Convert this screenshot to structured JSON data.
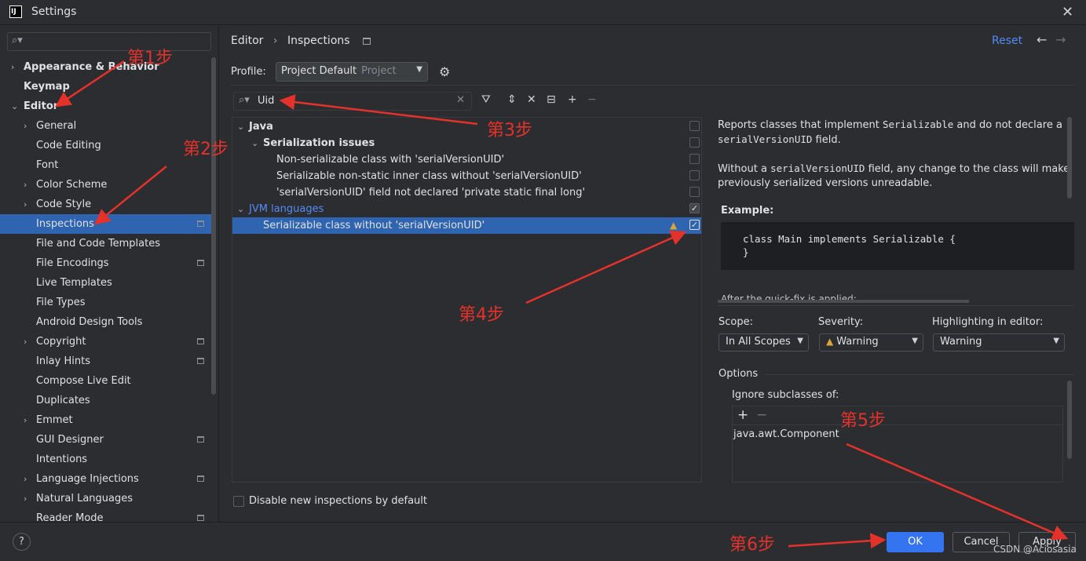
{
  "window": {
    "title": "Settings",
    "app_icon": "IJ"
  },
  "sidebar": {
    "items": [
      {
        "label": "Appearance & Behavior",
        "level": 0,
        "chevron": "right",
        "bold": true,
        "options_icon": false
      },
      {
        "label": "Keymap",
        "level": 0,
        "chevron": "none",
        "bold": true,
        "options_icon": false
      },
      {
        "label": "Editor",
        "level": 0,
        "chevron": "down",
        "bold": true,
        "options_icon": false
      },
      {
        "label": "General",
        "level": 1,
        "chevron": "right",
        "bold": false,
        "options_icon": false
      },
      {
        "label": "Code Editing",
        "level": 1,
        "chevron": "none",
        "bold": false,
        "options_icon": false
      },
      {
        "label": "Font",
        "level": 1,
        "chevron": "none",
        "bold": false,
        "options_icon": false
      },
      {
        "label": "Color Scheme",
        "level": 1,
        "chevron": "right",
        "bold": false,
        "options_icon": false
      },
      {
        "label": "Code Style",
        "level": 1,
        "chevron": "right",
        "bold": false,
        "options_icon": false
      },
      {
        "label": "Inspections",
        "level": 1,
        "chevron": "none",
        "bold": false,
        "options_icon": true,
        "selected": true
      },
      {
        "label": "File and Code Templates",
        "level": 1,
        "chevron": "none",
        "bold": false,
        "options_icon": false
      },
      {
        "label": "File Encodings",
        "level": 1,
        "chevron": "none",
        "bold": false,
        "options_icon": true
      },
      {
        "label": "Live Templates",
        "level": 1,
        "chevron": "none",
        "bold": false,
        "options_icon": false
      },
      {
        "label": "File Types",
        "level": 1,
        "chevron": "none",
        "bold": false,
        "options_icon": false
      },
      {
        "label": "Android Design Tools",
        "level": 1,
        "chevron": "none",
        "bold": false,
        "options_icon": false
      },
      {
        "label": "Copyright",
        "level": 1,
        "chevron": "right",
        "bold": false,
        "options_icon": true
      },
      {
        "label": "Inlay Hints",
        "level": 1,
        "chevron": "none",
        "bold": false,
        "options_icon": true
      },
      {
        "label": "Compose Live Edit",
        "level": 1,
        "chevron": "none",
        "bold": false,
        "options_icon": false
      },
      {
        "label": "Duplicates",
        "level": 1,
        "chevron": "none",
        "bold": false,
        "options_icon": false
      },
      {
        "label": "Emmet",
        "level": 1,
        "chevron": "right",
        "bold": false,
        "options_icon": false
      },
      {
        "label": "GUI Designer",
        "level": 1,
        "chevron": "none",
        "bold": false,
        "options_icon": true
      },
      {
        "label": "Intentions",
        "level": 1,
        "chevron": "none",
        "bold": false,
        "options_icon": false
      },
      {
        "label": "Language Injections",
        "level": 1,
        "chevron": "right",
        "bold": false,
        "options_icon": true
      },
      {
        "label": "Natural Languages",
        "level": 1,
        "chevron": "right",
        "bold": false,
        "options_icon": false
      },
      {
        "label": "Reader Mode",
        "level": 1,
        "chevron": "none",
        "bold": false,
        "options_icon": true
      }
    ]
  },
  "header": {
    "breadcrumb": [
      "Editor",
      "Inspections"
    ],
    "reset": "Reset"
  },
  "profile": {
    "label": "Profile:",
    "value": "Project Default",
    "sub": "Project"
  },
  "search": {
    "value": "Uid"
  },
  "inspection_tree": [
    {
      "label": "Java",
      "level": 0,
      "chevron": "down",
      "style": "bold",
      "checked": false
    },
    {
      "label": "Serialization issues",
      "level": 1,
      "chevron": "down",
      "style": "bold",
      "checked": false
    },
    {
      "label": "Non-serializable class with 'serialVersionUID'",
      "level": 2,
      "chevron": "none",
      "style": "normal",
      "checked": false
    },
    {
      "label": "Serializable non-static inner class without 'serialVersionUID'",
      "level": 2,
      "chevron": "none",
      "style": "normal",
      "checked": false
    },
    {
      "label": "'serialVersionUID' field not declared 'private static final long'",
      "level": 2,
      "chevron": "none",
      "style": "normal",
      "checked": false
    },
    {
      "label": "JVM languages",
      "level": 0,
      "chevron": "down",
      "style": "blue",
      "checked": true
    },
    {
      "label": "Serializable class without 'serialVersionUID'",
      "level": 1,
      "chevron": "none",
      "style": "normal",
      "checked": true,
      "selected": true,
      "warning": true
    }
  ],
  "disable_new": "Disable new inspections by default",
  "description": {
    "p1_a": "Reports classes that implement ",
    "p1_code1": "Serializable",
    "p1_b": " and do not declare a ",
    "p1_code2": "serialVersionUID",
    "p1_c": " field.",
    "p2_a": "Without a ",
    "p2_code": "serialVersionUID",
    "p2_b": " field, any change to the class will make previously serialized versions unreadable.",
    "example_heading": "Example:",
    "code": "class Main implements Serializable {\n}",
    "after": "After the quick-fix is applied:"
  },
  "fields": {
    "scope_label": "Scope:",
    "scope_value": "In All Scopes",
    "severity_label": "Severity:",
    "severity_value": "Warning",
    "highlight_label": "Highlighting in editor:",
    "highlight_value": "Warning"
  },
  "options": {
    "label": "Options",
    "ignore_label": "Ignore subclasses of:",
    "items": [
      "java.awt.Component"
    ]
  },
  "footer": {
    "ok": "OK",
    "cancel": "Cancel",
    "apply": "Apply",
    "help": "?",
    "watermark": "CSDN @Aciosasia"
  },
  "annotations": [
    "第1步",
    "第2步",
    "第3步",
    "第4步",
    "第5步",
    "第6步"
  ],
  "colors": {
    "accent": "#3574f0",
    "selection": "#2e64b0",
    "annotation_red": "#e4322b",
    "warning": "#d6a53d",
    "link": "#548af7"
  }
}
